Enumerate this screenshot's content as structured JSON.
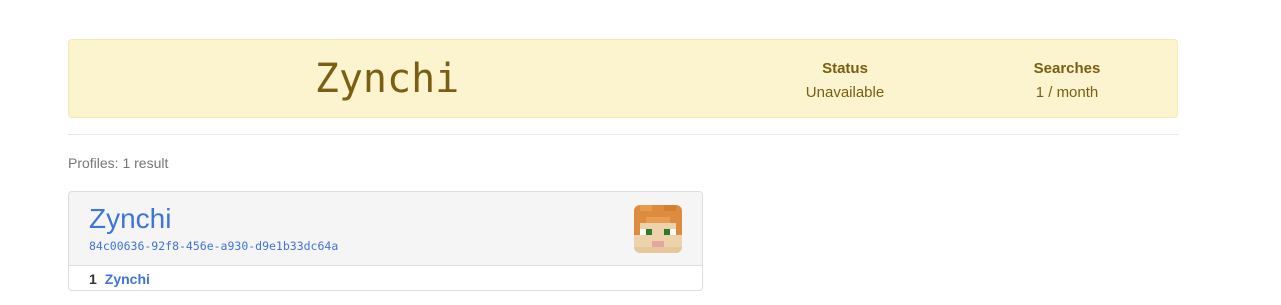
{
  "banner": {
    "name": "Zynchi",
    "status_label": "Status",
    "status_value": "Unavailable",
    "searches_label": "Searches",
    "searches_value": "1 / month"
  },
  "results": {
    "summary": "Profiles: 1 result"
  },
  "profile": {
    "name": "Zynchi",
    "uuid": "84c00636-92f8-456e-a930-d9e1b33dc64a",
    "avatar_icon": "player-head-avatar",
    "name_history": [
      {
        "index": "1",
        "name": "Zynchi"
      }
    ]
  },
  "colors": {
    "banner_bg": "#fcf3cf",
    "banner_text": "#7a5f12",
    "link": "#3f74d9",
    "muted": "#777777"
  }
}
